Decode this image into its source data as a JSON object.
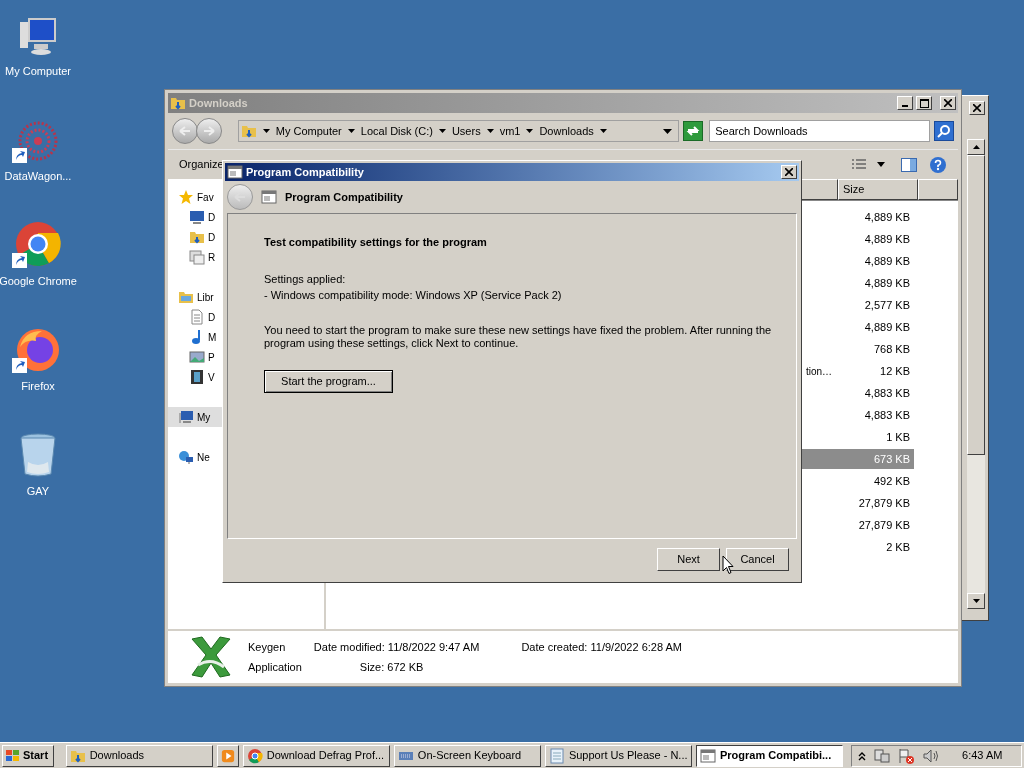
{
  "desktop_icons": [
    {
      "label": "My Computer",
      "kind": "computer",
      "shortcut": false
    },
    {
      "label": "DataWagon...",
      "kind": "dots",
      "shortcut": true
    },
    {
      "label": "Google Chrome",
      "kind": "chrome",
      "shortcut": true
    },
    {
      "label": "Firefox",
      "kind": "firefox",
      "shortcut": true
    },
    {
      "label": "GAY",
      "kind": "bin",
      "shortcut": false
    }
  ],
  "explorer": {
    "title": "Downloads",
    "breadcrumb": [
      "My Computer",
      "Local Disk (C:)",
      "Users",
      "vm1",
      "Downloads"
    ],
    "search": {
      "placeholder": "Search Downloads"
    },
    "organize": "Organize",
    "nav_items": [
      {
        "label": "Fav",
        "kind": "star",
        "group": true,
        "selected": false
      },
      {
        "label": "D",
        "kind": "desktop",
        "group": false,
        "selected": false
      },
      {
        "label": "D",
        "kind": "folder",
        "group": false,
        "selected": false
      },
      {
        "label": "R",
        "kind": "recent",
        "group": false,
        "selected": false
      },
      {
        "label": "Libr",
        "kind": "library",
        "group": true,
        "selected": false
      },
      {
        "label": "D",
        "kind": "document",
        "group": false,
        "selected": false
      },
      {
        "label": "M",
        "kind": "music",
        "group": false,
        "selected": false
      },
      {
        "label": "P",
        "kind": "pictures",
        "group": false,
        "selected": false
      },
      {
        "label": "V",
        "kind": "video",
        "group": false,
        "selected": false
      },
      {
        "label": "My",
        "kind": "computer",
        "group": true,
        "selected": true
      },
      {
        "label": "Ne",
        "kind": "network",
        "group": true,
        "selected": false
      }
    ],
    "size_header": "Size",
    "rows": [
      {
        "size": "4,889 KB",
        "selected": false
      },
      {
        "size": "4,889 KB",
        "selected": false
      },
      {
        "size": "4,889 KB",
        "selected": false
      },
      {
        "size": "4,889 KB",
        "selected": false
      },
      {
        "size": "2,577 KB",
        "selected": false
      },
      {
        "size": "4,889 KB",
        "selected": false
      },
      {
        "size": "768 KB",
        "selected": false
      },
      {
        "name": "tion…",
        "size": "12 KB",
        "selected": false
      },
      {
        "size": "4,883 KB",
        "selected": false
      },
      {
        "size": "4,883 KB",
        "selected": false
      },
      {
        "size": "1 KB",
        "selected": false
      },
      {
        "size": "673 KB",
        "selected": true
      },
      {
        "size": "492 KB",
        "selected": false
      },
      {
        "size": "27,879 KB",
        "selected": false
      },
      {
        "size": "27,879 KB",
        "selected": false
      },
      {
        "size": "2 KB",
        "selected": false
      }
    ],
    "details": {
      "name": "Keygen",
      "type": "Application",
      "modified_label": "Date modified:",
      "modified": "11/8/2022 9:47 AM",
      "created_label": "Date created:",
      "created": "11/9/2022 6:28 AM",
      "size_label": "Size:",
      "size": "672 KB"
    }
  },
  "dialog": {
    "title": "Program Compatibility",
    "header": "Program Compatibility",
    "heading": "Test compatibility settings for the program",
    "settings_label": "Settings applied:",
    "settings": [
      "- Windows compatibility mode: Windows XP (Service Pack 2)"
    ],
    "message": "You need to start the program to make sure these new settings have fixed the problem. After running the program using these settings, click Next to continue.",
    "action": "Start the program...",
    "buttons": [
      "Next",
      "Cancel"
    ]
  },
  "taskbar": {
    "start": "Start",
    "items": [
      {
        "label": "Downloads",
        "kind": "folder",
        "selected": false
      },
      {
        "kind": "media",
        "selected": false
      },
      {
        "label": "Download Defrag Prof...",
        "kind": "chrome",
        "selected": false
      },
      {
        "label": "On-Screen Keyboard",
        "kind": "keyboard",
        "selected": false
      },
      {
        "label": "Support Us Please - N...",
        "kind": "notepad",
        "selected": false
      },
      {
        "label": "Program Compatibi...",
        "kind": "window",
        "selected": true
      }
    ],
    "clock": "6:43 AM"
  }
}
